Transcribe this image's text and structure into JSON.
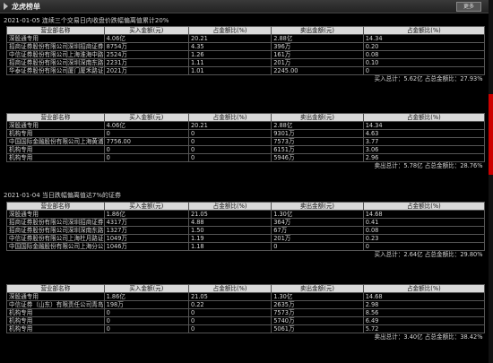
{
  "header": {
    "title": "龙虎榜单",
    "more_label": "更多"
  },
  "columns": [
    "营业部名称",
    "买入金额(元)",
    "占金额比(%)",
    "卖出金额(元)",
    "占金额比(%)"
  ],
  "sections": [
    {
      "title": "2021-01-05 连续三个交易日内收盘价跌幅偏离值累计20%",
      "buy": {
        "rows": [
          [
            "深股通专用",
            "4.06亿",
            "20.21",
            "2.88亿",
            "14.34"
          ],
          [
            "招商证券股份有限公司深圳招商证券大厦证券营业部",
            "8754万",
            "4.35",
            "396万",
            "0.20"
          ],
          [
            "中信证券股份有限公司上海淮海中路证券营业部",
            "2524万",
            "1.26",
            "161万",
            "0.08"
          ],
          [
            "招商证券股份有限公司深圳深南东路证券营业部",
            "2231万",
            "1.11",
            "201万",
            "0.10"
          ],
          [
            "华泰证券股份有限公司厦门厦禾路证券营业部",
            "2021万",
            "1.01",
            "2245.00",
            "0"
          ]
        ],
        "total": "买入总计：5.62亿  占总金额比：27.93%"
      },
      "sell": {
        "rows": [
          [
            "深股通专用",
            "4.06亿",
            "20.21",
            "2.88亿",
            "14.34"
          ],
          [
            "机构专用",
            "0",
            "0",
            "9301万",
            "4.63"
          ],
          [
            "中国国际金融股份有限公司上海黄浦区湖滨路证券营业部",
            "7756.00",
            "0",
            "7573万",
            "3.77"
          ],
          [
            "机构专用",
            "0",
            "0",
            "6151万",
            "3.06"
          ],
          [
            "机构专用",
            "0",
            "0",
            "5946万",
            "2.96"
          ]
        ],
        "total": "卖出总计：5.78亿  占总金额比：28.76%"
      }
    },
    {
      "title": "2021-01-04 当日跌幅偏离值达7%的证券",
      "buy": {
        "rows": [
          [
            "深股通专用",
            "1.86亿",
            "21.05",
            "1.30亿",
            "14.68"
          ],
          [
            "招商证券股份有限公司深圳招商证券大厦证券营业部",
            "4317万",
            "4.88",
            "364万",
            "0.41"
          ],
          [
            "招商证券股份有限公司深圳深南东路证券营业部",
            "1327万",
            "1.50",
            "67万",
            "0.08"
          ],
          [
            "中信证券股份有限公司上海杜月路证券营业部",
            "1049万",
            "1.19",
            "201万",
            "0.23"
          ],
          [
            "中国国际金融股份有限公司上海分公司",
            "1046万",
            "1.18",
            "0",
            "0"
          ]
        ],
        "total": "买入总计：2.64亿  占总金额比：29.80%"
      },
      "sell": {
        "rows": [
          [
            "深股通专用",
            "1.86亿",
            "21.05",
            "1.30亿",
            "14.68"
          ],
          [
            "中信证券（山东）有限责任公司青岛南京路证券营业部",
            "198万",
            "0.22",
            "2635万",
            "2.98"
          ],
          [
            "机构专用",
            "0",
            "0",
            "7573万",
            "8.56"
          ],
          [
            "机构专用",
            "0",
            "0",
            "5740万",
            "6.49"
          ],
          [
            "机构专用",
            "0",
            "0",
            "5061万",
            "5.72"
          ]
        ],
        "total": "卖出总计：3.40亿  占总金额比：38.42%"
      }
    }
  ]
}
